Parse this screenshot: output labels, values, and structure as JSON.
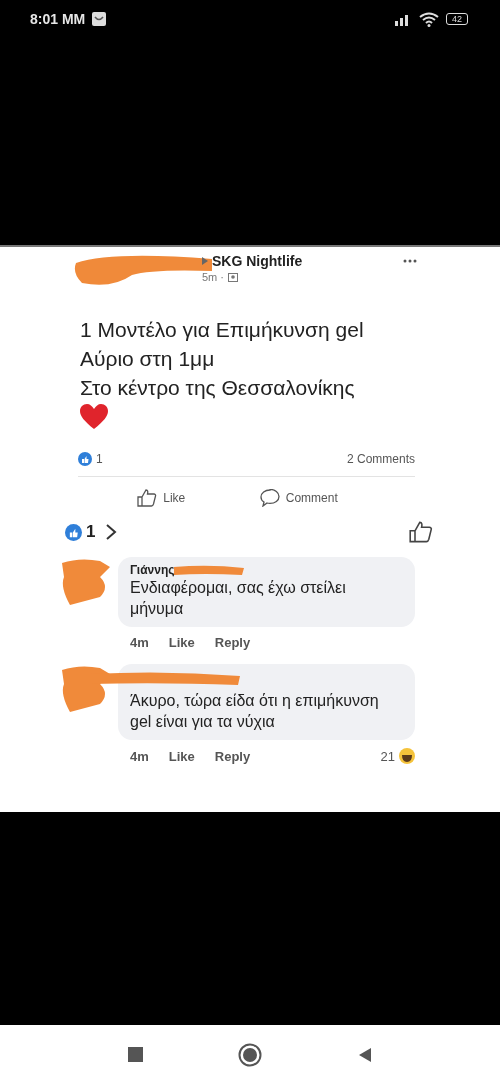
{
  "status_bar": {
    "time": "8:01 MM",
    "battery": "42"
  },
  "post": {
    "page": "SKG Nightlife",
    "time": "5m ·",
    "lines": [
      "1 Μοντέλο για Επιμήκυνση gel",
      "Αύριο στη 1μμ",
      "Στο κέντρο της Θεσσαλονίκης"
    ],
    "reaction_count": "1",
    "comments_count": "2 Comments",
    "actions": [
      "Like",
      "Comment"
    ]
  },
  "comment_reactions": "1",
  "comments": [
    {
      "name": "Γιάννης",
      "text": "Ενδιαφέρομαι, σας έχω στείλει μήνυμα",
      "time": "4m",
      "actions": [
        "Like",
        "Reply"
      ]
    },
    {
      "text": "Άκυρο, τώρα είδα ότι η επιμήκυνση gel είναι για τα νύχια",
      "time": "4m",
      "actions": [
        "Like",
        "Reply"
      ],
      "reaction_count": "21"
    }
  ]
}
